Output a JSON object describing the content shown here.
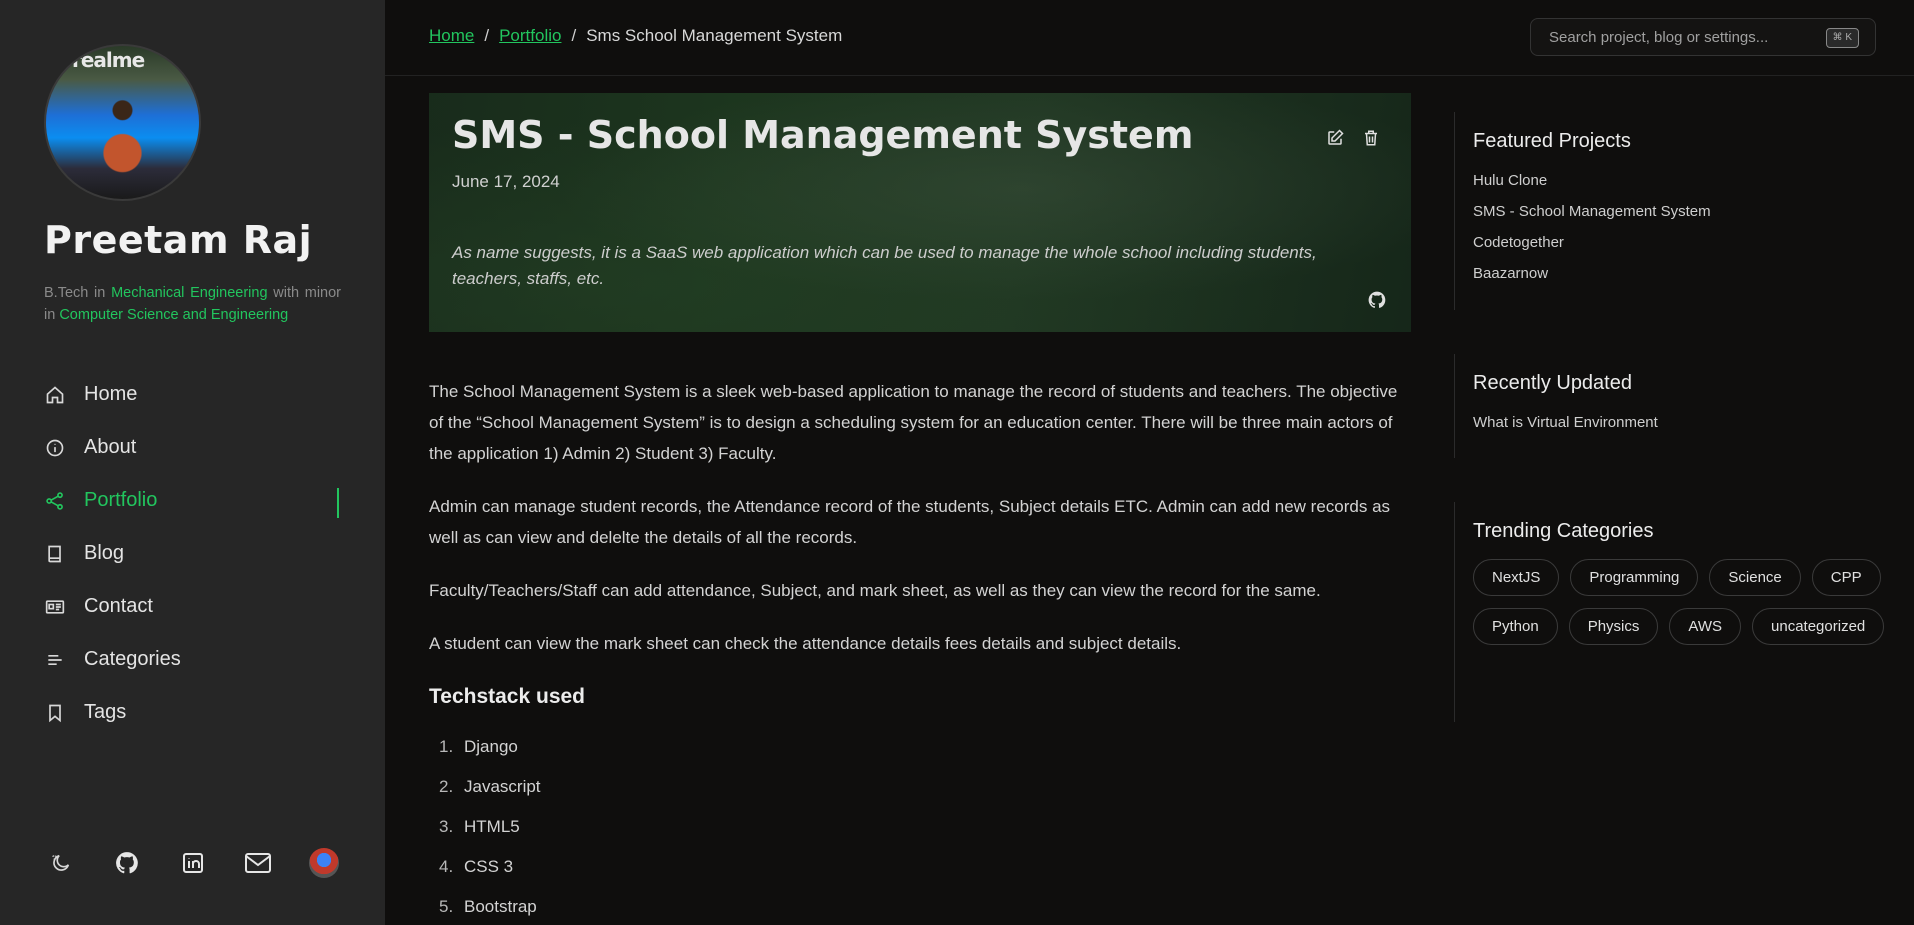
{
  "sidebar": {
    "avatar_text": "realme",
    "name": "Preetam Raj",
    "bio": {
      "part1": "B.Tech in ",
      "major": "Mechanical Engineering",
      "part2": " with minor in ",
      "minor": "Computer Science and Engineering"
    },
    "nav": [
      {
        "label": "Home",
        "icon": "home-icon"
      },
      {
        "label": "About",
        "icon": "info-icon"
      },
      {
        "label": "Portfolio",
        "icon": "share-icon",
        "active": true
      },
      {
        "label": "Blog",
        "icon": "book-icon"
      },
      {
        "label": "Contact",
        "icon": "id-card-icon"
      },
      {
        "label": "Categories",
        "icon": "lines-icon"
      },
      {
        "label": "Tags",
        "icon": "bookmark-icon"
      }
    ],
    "social": [
      "theme-toggle-icon",
      "github-icon",
      "linkedin-icon",
      "mail-icon",
      "avatar"
    ]
  },
  "topbar": {
    "breadcrumb": {
      "home": "Home",
      "sep": "/",
      "portfolio": "Portfolio",
      "current": "Sms School Management System"
    },
    "search": {
      "placeholder": "Search project, blog or settings...",
      "shortcut": "⌘ K"
    }
  },
  "hero": {
    "title": "SMS - School Management System",
    "date": "June 17, 2024",
    "description": "As name suggests, it is a SaaS web application which can be used to manage the whole school including students, teachers, staffs, etc."
  },
  "content": {
    "paragraphs": [
      "The School Management System is a sleek web-based application to manage the record of students and teachers. The objective of the “School Management System” is to design a scheduling system for an education center. There will be three main actors of the application 1) Admin 2) Student 3) Faculty.",
      "Admin can manage student records, the Attendance record of the students, Subject details ETC. Admin can add new records as well as can view and delelte the details of all the records.",
      "Faculty/Teachers/Staff can add attendance, Subject, and mark sheet, as well as they can view the record for the same.",
      "A student can view the mark sheet can check the attendance details fees details and subject details."
    ],
    "techstack_heading": "Techstack used",
    "techstack": [
      {
        "num": "1.",
        "label": "Django"
      },
      {
        "num": "2.",
        "label": "Javascript"
      },
      {
        "num": "3.",
        "label": "HTML5"
      },
      {
        "num": "4.",
        "label": "CSS 3"
      },
      {
        "num": "5.",
        "label": "Bootstrap"
      }
    ]
  },
  "rail": {
    "featured": {
      "heading": "Featured Projects",
      "items": [
        "Hulu Clone",
        "SMS - School Management System",
        "Codetogether",
        "Baazarnow"
      ]
    },
    "recent": {
      "heading": "Recently Updated",
      "items": [
        "What is Virtual Environment"
      ]
    },
    "trending": {
      "heading": "Trending Categories",
      "tags": [
        "NextJS",
        "Programming",
        "Science",
        "CPP",
        "Python",
        "Physics",
        "AWS",
        "uncategorized"
      ]
    }
  },
  "colors": {
    "accent": "#22c55e",
    "sidebar_bg": "#262626",
    "page_bg": "#0f0e0d"
  }
}
